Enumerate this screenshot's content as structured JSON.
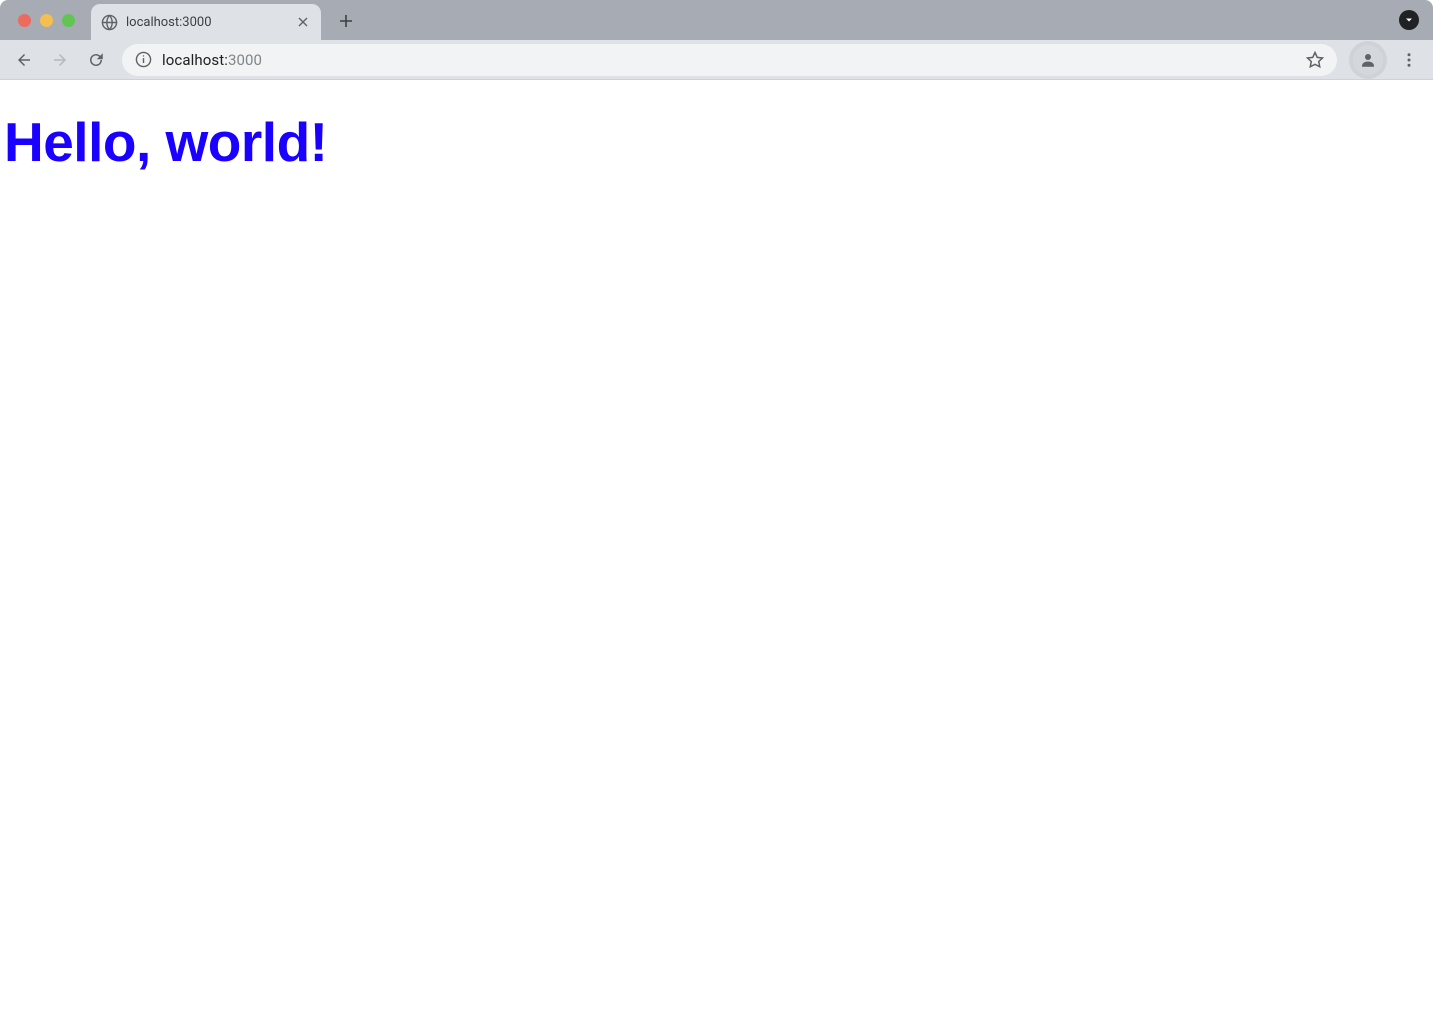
{
  "browser": {
    "tab": {
      "title": "localhost:3000"
    },
    "url": {
      "host": "localhost:",
      "port": "3000"
    }
  },
  "page": {
    "heading": "Hello, world!"
  }
}
